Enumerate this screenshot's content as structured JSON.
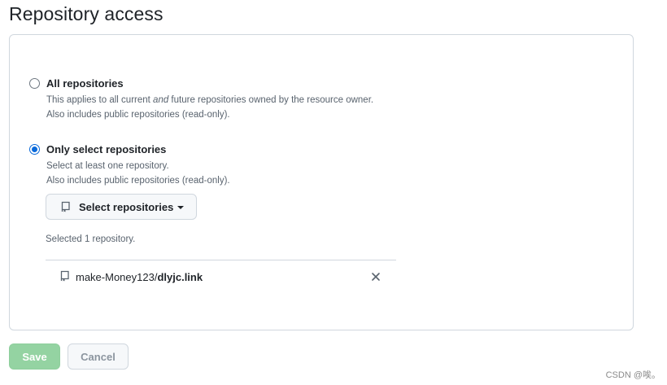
{
  "page": {
    "title": "Repository access"
  },
  "options": [
    {
      "label": "All repositories",
      "checked": false,
      "note_line1_pre": "This applies to all current ",
      "note_line1_em": "and",
      "note_line1_post": " future repositories owned by the resource owner.",
      "note_line2": "Also includes public repositories (read-only)."
    },
    {
      "label": "Only select repositories",
      "checked": true,
      "note_line1": "Select at least one repository.",
      "note_line2": "Also includes public repositories (read-only)."
    }
  ],
  "select_button": {
    "label": "Select repositories",
    "icon": "repo-icon"
  },
  "selected_count": "Selected 1 repository.",
  "repos": [
    {
      "owner": "make-Money123/",
      "name": "dlyjc.link",
      "icon": "repo-icon",
      "remove_icon": "close-icon"
    }
  ],
  "actions": {
    "save_label": "Save",
    "cancel_label": "Cancel"
  },
  "watermark": "CSDN @唉。",
  "colors": {
    "accent": "#0969da",
    "save_disabled": "#94d3a2",
    "border": "#d0d7de",
    "muted_text": "#59636e"
  }
}
